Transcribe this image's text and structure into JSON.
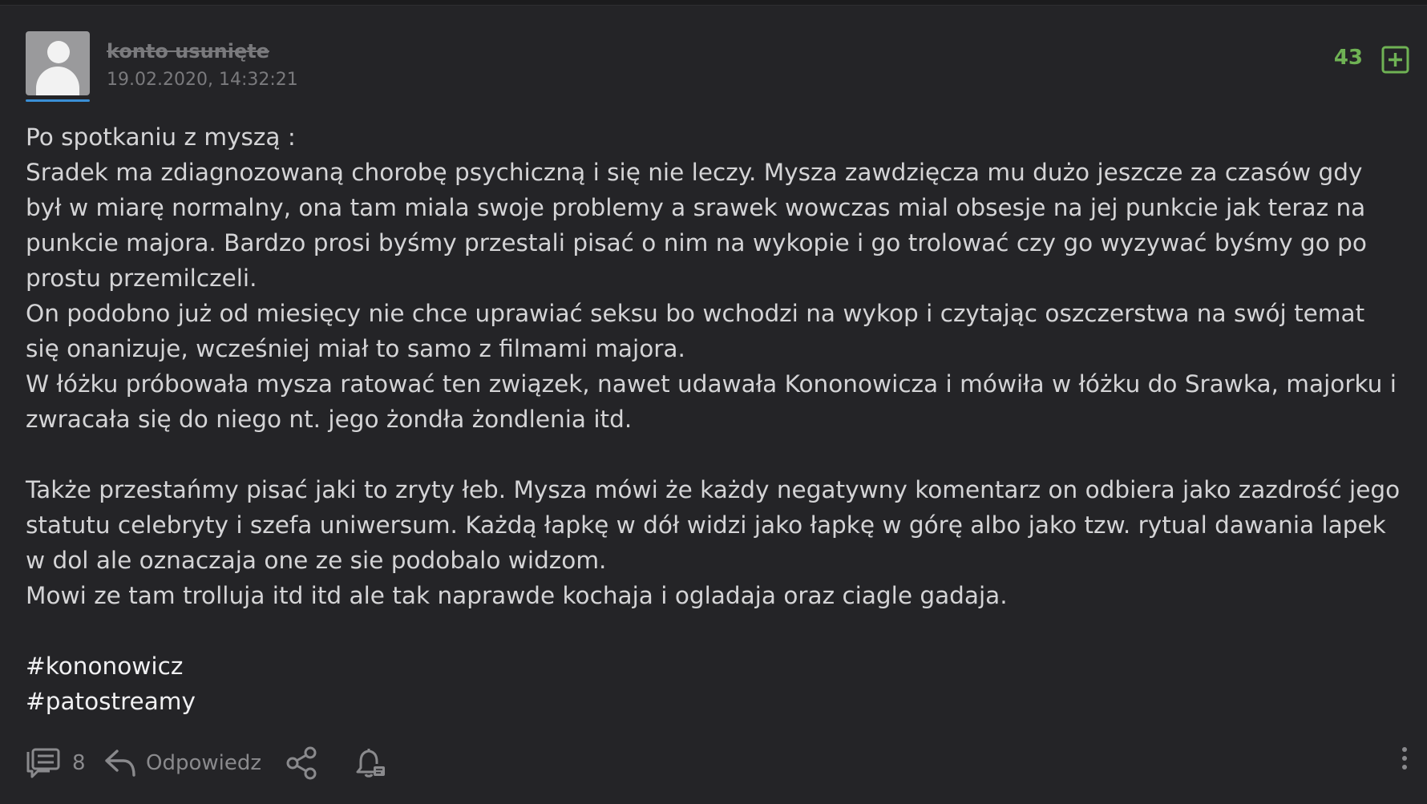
{
  "post": {
    "author": "konto usunięte",
    "timestamp": "19.02.2020, 14:32:21",
    "votes": "43",
    "paragraphs": [
      "Po spotkaniu z myszą :",
      "Sradek ma zdiagnozowaną chorobę psychiczną i się nie leczy. Mysza zawdzięcza mu dużo jeszcze za czasów gdy był w miarę normalny, ona tam miala swoje problemy a srawek wowczas mial obsesje na jej punkcie jak teraz na punkcie majora. Bardzo prosi byśmy przestali pisać o nim na wykopie i go trolować czy go wyzywać byśmy go po prostu przemilczeli.",
      "On podobno już od miesięcy nie chce uprawiać seksu bo wchodzi na wykop i czytając oszczerstwa na swój temat się onanizuje, wcześniej miał to samo z filmami majora.",
      "W łóżku próbowała mysza ratować ten związek, nawet udawała Kononowicza i mówiła w łóżku do Srawka, majorku i zwracała się do niego nt. jego żondła żondlenia itd.",
      "Także przestańmy pisać jaki to zryty łeb. Mysza mówi że każdy negatywny komentarz on odbiera jako zazdrość jego statutu celebryty i szefa uniwersum. Każdą łapkę w dół widzi jako łapkę w górę albo jako tzw. rytual dawania lapek w dol ale oznaczaja one ze sie podobalo widzom.",
      "Mowi ze tam trolluja itd itd ale tak naprawde kochaja i ogladaja oraz ciagle gadaja."
    ],
    "tags": [
      "#kononowicz",
      "#patostreamy"
    ]
  },
  "footer": {
    "comments_count": "8",
    "reply_label": "Odpowiedz"
  },
  "icons": {
    "avatar": "default-user-avatar",
    "plus": "plus-square-icon",
    "comments": "comments-icon",
    "reply": "reply-arrow-icon",
    "share": "share-icon",
    "notify": "bell-icon",
    "more": "vertical-dots-icon"
  },
  "colors": {
    "background": "#242427",
    "votes": "#6fb254",
    "avatar_bar": "#3a8fd6",
    "muted": "#8a8a8d"
  }
}
